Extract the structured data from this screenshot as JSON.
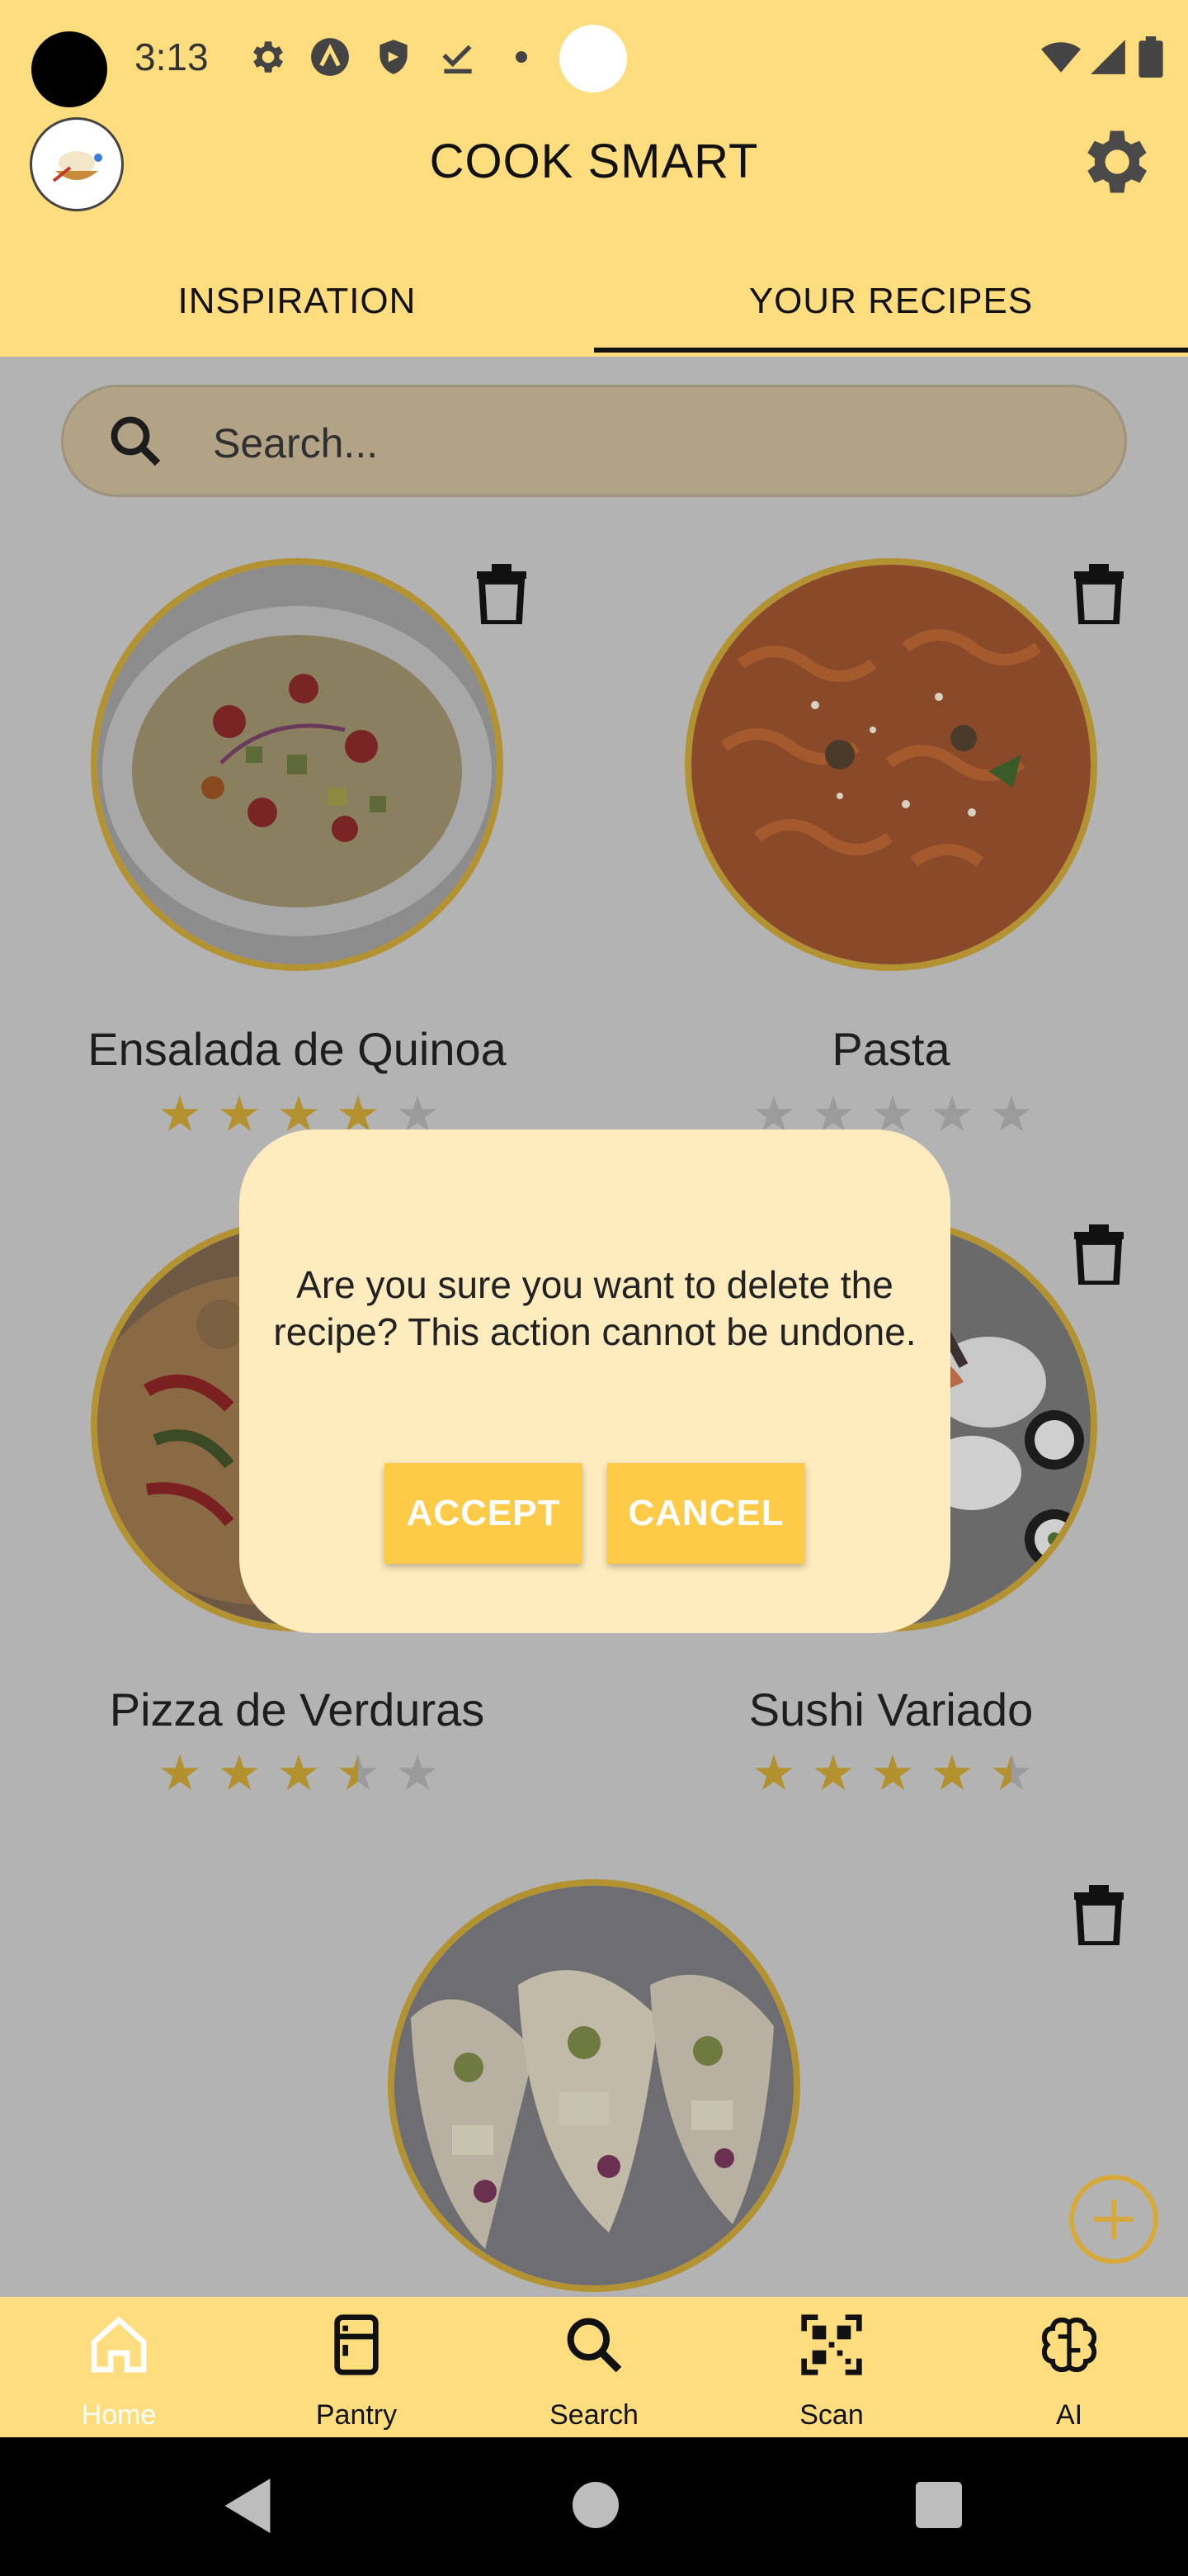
{
  "status_bar": {
    "time": "3:13"
  },
  "app_bar": {
    "title": "COOK SMART",
    "tabs": [
      {
        "label": "INSPIRATION",
        "active": false
      },
      {
        "label": "YOUR RECIPES",
        "active": true
      }
    ]
  },
  "search": {
    "placeholder": "Search..."
  },
  "recipes": [
    {
      "name": "Ensalada de Quinoa",
      "rating": 4
    },
    {
      "name": "Pasta",
      "rating": 0
    },
    {
      "name": "Pizza de Verduras",
      "rating": 3.5
    },
    {
      "name": "Sushi Variado",
      "rating": 4.5
    }
  ],
  "dialog": {
    "message": "Are you sure you want to delete the recipe? This action cannot be undone.",
    "accept_label": "ACCEPT",
    "cancel_label": "CANCEL"
  },
  "bottom_nav": [
    {
      "label": "Home",
      "icon": "home-icon",
      "active": true
    },
    {
      "label": "Pantry",
      "icon": "fridge-icon",
      "active": false
    },
    {
      "label": "Search",
      "icon": "search-icon",
      "active": false
    },
    {
      "label": "Scan",
      "icon": "qr-code-icon",
      "active": false
    },
    {
      "label": "AI",
      "icon": "brain-icon",
      "active": false
    }
  ],
  "colors": {
    "app_bar": "#fedd7f",
    "accent_gold": "#b3912e",
    "dialog_bg": "#feecbf",
    "dialog_button": "#fdcb48",
    "scrim": "#b3b3b3"
  }
}
